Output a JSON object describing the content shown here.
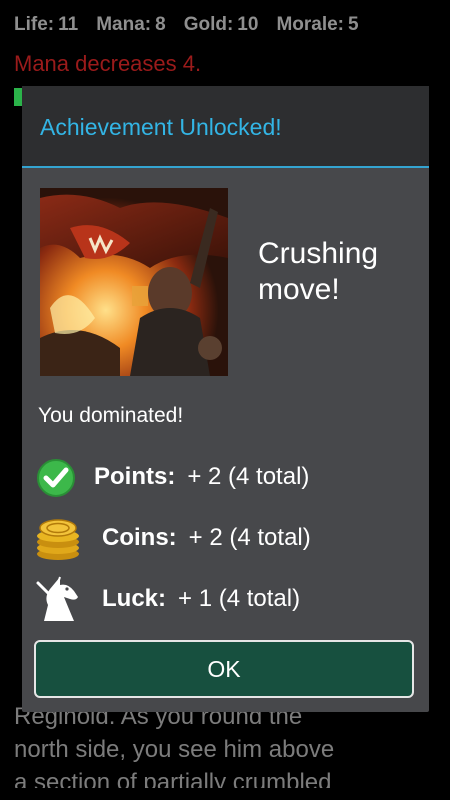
{
  "stats": [
    {
      "label": "Life:",
      "value": "11"
    },
    {
      "label": "Mana:",
      "value": "8"
    },
    {
      "label": "Gold:",
      "value": "10"
    },
    {
      "label": "Morale:",
      "value": "5"
    }
  ],
  "story": {
    "warning": "Mana decreases 4.",
    "bottom_lines": [
      "Reginold. As you round the",
      "north side, you see him above",
      "a section of partially crumbled"
    ]
  },
  "dialog": {
    "title": "Achievement Unlocked!",
    "achievement_name": "Crushing move!",
    "message": "You dominated!",
    "rewards": [
      {
        "icon": "checkmark-icon",
        "label": "Points:",
        "value": "+ 2 (4 total)"
      },
      {
        "icon": "coins-icon",
        "label": "Coins:",
        "value": "+ 2 (4 total)"
      },
      {
        "icon": "unicorn-icon",
        "label": "Luck:",
        "value": "+ 1 (4 total)"
      }
    ],
    "ok_label": "OK"
  },
  "colors": {
    "accent": "#33b5e5",
    "warning": "#9b1b1b",
    "button": "#17503f",
    "dialog_bg": "#47484b"
  }
}
